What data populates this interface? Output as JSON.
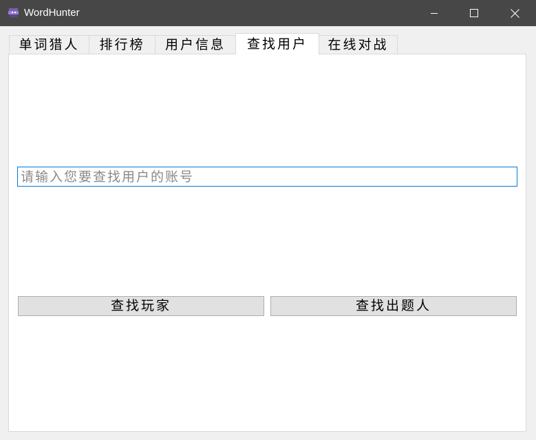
{
  "window": {
    "title": "WordHunter",
    "icon": "wordhunter-app-icon"
  },
  "titlebar_controls": {
    "minimize_icon": "minimize-icon",
    "maximize_icon": "maximize-icon",
    "close_icon": "close-icon"
  },
  "tabs": [
    {
      "label": "单词猎人",
      "active": false
    },
    {
      "label": "排行榜",
      "active": false
    },
    {
      "label": "用户信息",
      "active": false
    },
    {
      "label": "查找用户",
      "active": true
    },
    {
      "label": "在线对战",
      "active": false
    }
  ],
  "search": {
    "placeholder": "请输入您要查找用户的账号",
    "value": ""
  },
  "buttons": {
    "find_player": "查找玩家",
    "find_author": "查找出题人"
  },
  "colors": {
    "titlebar": "#474747",
    "input_focus_border": "#0078d7",
    "button_bg": "#e1e1e1"
  }
}
